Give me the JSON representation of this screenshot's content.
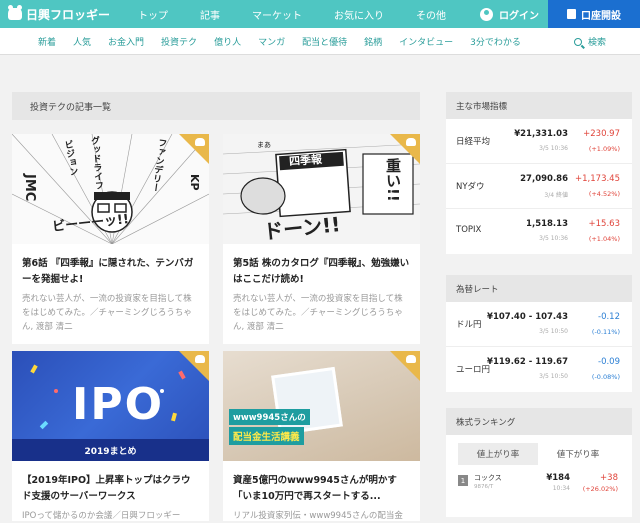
{
  "header": {
    "logo": "日興フロッギー",
    "nav": [
      "トップ",
      "記事",
      "マーケット",
      "お気に入り",
      "その他"
    ],
    "login": "ログイン",
    "account_button": "口座開設"
  },
  "subnav": {
    "items": [
      "新着",
      "人気",
      "お金入門",
      "投資テク",
      "億り人",
      "マンガ",
      "配当と優待",
      "銘柄",
      "インタビュー",
      "3分でわかる"
    ],
    "search": "検索"
  },
  "section": {
    "title": "投資テクの記事一覧"
  },
  "articles": [
    {
      "title": "第6話 『四季報』に隠された、テンバガーを発掘せよ!",
      "desc": "売れない芸人が、一流の投資家を目指して株をはじめてみた。／チャーミングじろうちゃん, 渡部 清二",
      "thumb_text": [
        "ビジョン",
        "グッドライフ",
        "ファンデリー",
        "JMC",
        "KP",
        "ビーーーッ!!"
      ]
    },
    {
      "title": "第5話 株のカタログ『四季報』、勉強嫌いはここだけ読め!",
      "desc": "売れない芸人が、一流の投資家を目指して株をはじめてみた。／チャーミングじろうちゃん, 渡部 清二",
      "thumb_text": [
        "四季報",
        "ドーン!!",
        "重い!!",
        "まあ"
      ]
    },
    {
      "title": "【2019年IPO】上昇率トップはクラウド支援のサーバーワークス",
      "desc": "IPOって儲かるのか会議／日興フロッギー",
      "thumb_text": [
        "IPO",
        "2019まとめ"
      ]
    },
    {
      "title": "資産5億円のwww9945さんが明かす「いま10万円で再スタートする...",
      "desc": "リアル投資家列伝・www9945さんの配当金",
      "thumb_text": [
        "www9945さんの",
        "配当金生活講義"
      ]
    }
  ],
  "market": {
    "title": "主な市場指標",
    "rows": [
      {
        "name": "日経平均",
        "price": "¥21,331.03",
        "time": "3/5 10:36",
        "change": "+230.97",
        "pct": "(+1.09%)",
        "dir": "up"
      },
      {
        "name": "NYダウ",
        "price": "27,090.86",
        "time": "3/4 終値",
        "change": "+1,173.45",
        "pct": "(+4.52%)",
        "dir": "up"
      },
      {
        "name": "TOPIX",
        "price": "1,518.13",
        "time": "3/5 10:36",
        "change": "+15.63",
        "pct": "(+1.04%)",
        "dir": "up"
      }
    ]
  },
  "fx": {
    "title": "為替レート",
    "rows": [
      {
        "name": "ドル円",
        "price": "¥107.40 - 107.43",
        "time": "3/5 10:50",
        "change": "-0.12",
        "pct": "(-0.11%)",
        "dir": "down"
      },
      {
        "name": "ユーロ円",
        "price": "¥119.62 - 119.67",
        "time": "3/5 10:50",
        "change": "-0.09",
        "pct": "(-0.08%)",
        "dir": "down"
      }
    ]
  },
  "ranking": {
    "title": "株式ランキング",
    "tabs": [
      "値上がり率",
      "値下がり率"
    ],
    "rows": [
      {
        "rank": "1",
        "name": "コックス",
        "code": "9876/T",
        "price": "¥184",
        "time": "10:34",
        "change": "+38",
        "pct": "(+26.02%)"
      }
    ]
  },
  "colors": {
    "brand": "#4fc6c2",
    "account": "#1b6fd0",
    "up": "#e0443a",
    "down": "#2b7fd4"
  }
}
